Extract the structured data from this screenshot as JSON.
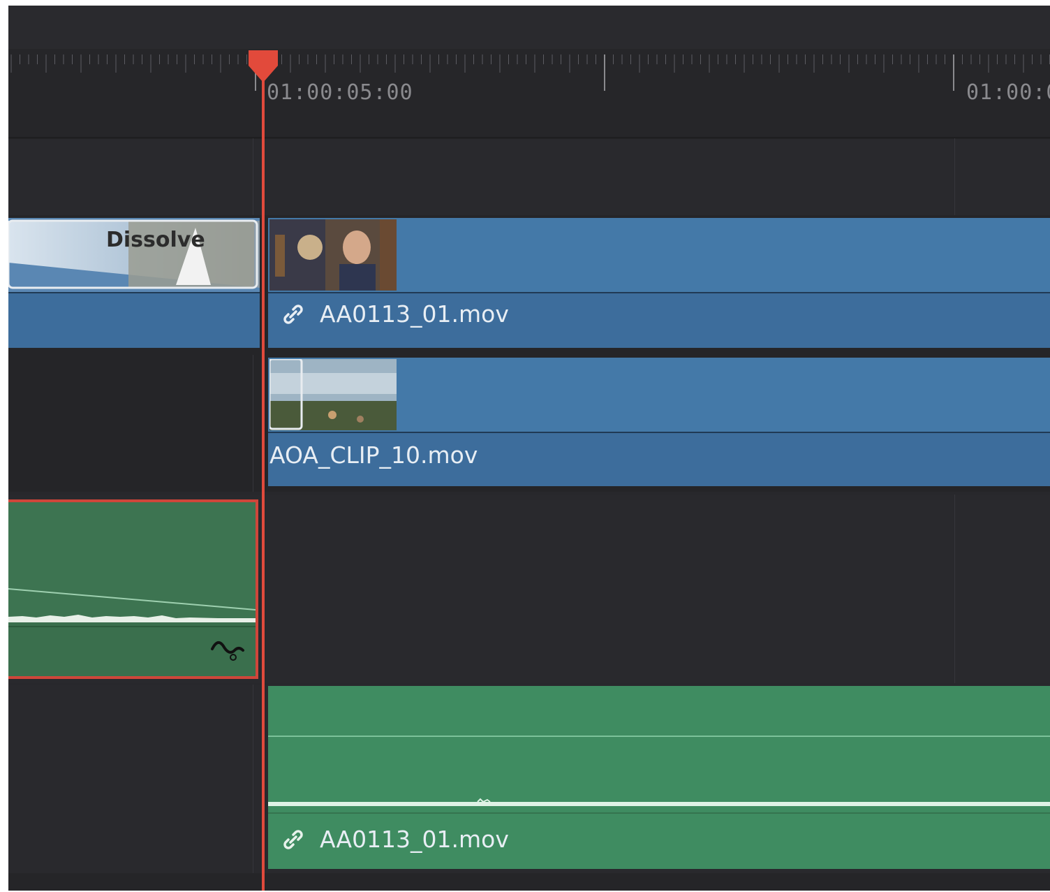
{
  "ruler": {
    "timecode_1": "01:00:05:00",
    "timecode_2": "01:00:0"
  },
  "video_track_2": {
    "transition_label": "Dissolve",
    "clip": {
      "name": "AA0113_01.mov",
      "linked": true
    }
  },
  "video_track_1": {
    "clip": {
      "name": "AOA_CLIP_10.mov"
    }
  },
  "audio_track_2": {
    "clip": {
      "name": "AA0113_01.mov",
      "linked": true
    }
  },
  "colors": {
    "video_clip": "#3d6d9c",
    "audio_clip": "#3f8c61",
    "playhead": "#e04a3c",
    "selection": "#d0463a"
  },
  "icons": [
    "link-icon",
    "playhead-icon",
    "curve-icon"
  ]
}
